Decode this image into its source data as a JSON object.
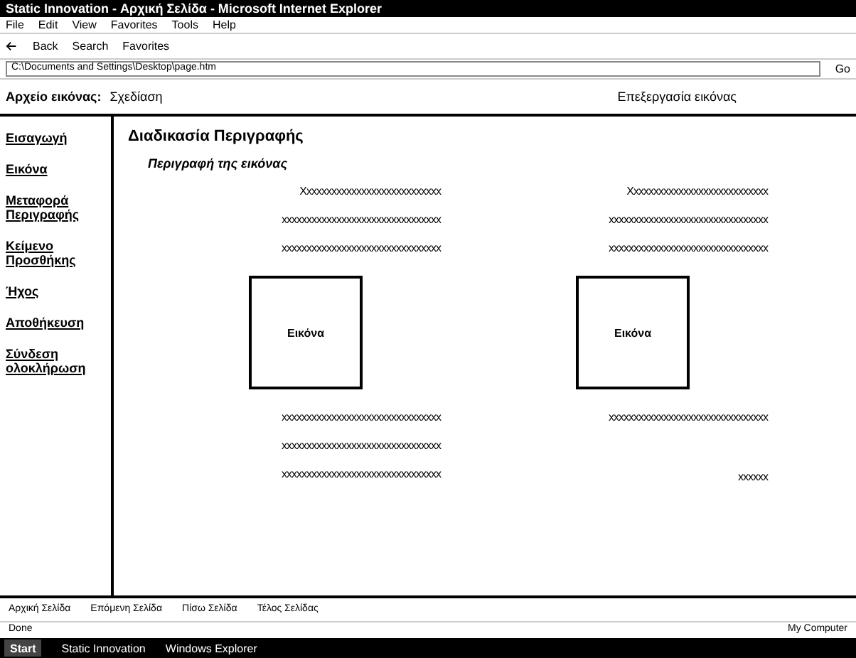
{
  "window": {
    "title": "Static Innovation - Αρχική Σελίδα - Microsoft Internet Explorer"
  },
  "menu": [
    "File",
    "Edit",
    "View",
    "Favorites",
    "Tools",
    "Help"
  ],
  "toolbar": [
    "Back",
    "Search",
    "Favorites"
  ],
  "address": {
    "value": "C:\\Documents and Settings\\Desktop\\page.htm",
    "go": "Go"
  },
  "header": {
    "label": "Αρχείο εικόνας:",
    "value": "Σχεδίαση",
    "right": "Επεξεργασία εικόνας"
  },
  "sidebar": [
    {
      "label": "Εισαγωγή"
    },
    {
      "label": "Εικόνα"
    },
    {
      "label": "Μεταφορά Περιγραφής"
    },
    {
      "label": "Κείμενο Προσθήκης"
    },
    {
      "label": "Ήχος"
    },
    {
      "label": "Αποθήκευση"
    },
    {
      "label": "Σύνδεση ολοκλήρωση"
    }
  ],
  "content": {
    "title": "Διαδικασία Περιγραφής",
    "subtitle": "Περιγραφή της εικόνας",
    "columns": [
      {
        "lines": [
          "Χxxxxxxxxxxxxxxxxxxxxxxxxxxx",
          "xxxxxxxxxxxxxxxxxxxxxxxxxxxxxxxx",
          "xxxxxxxxxxxxxxxxxxxxxxxxxxxxxxxx"
        ],
        "box": "Εικόνα",
        "after": [
          "xxxxxxxxxxxxxxxxxxxxxxxxxxxxxxxx",
          "xxxxxxxxxxxxxxxxxxxxxxxxxxxxxxxx",
          "xxxxxxxxxxxxxxxxxxxxxxxxxxxxxxxx"
        ]
      },
      {
        "lines": [
          "Χxxxxxxxxxxxxxxxxxxxxxxxxxxx",
          "xxxxxxxxxxxxxxxxxxxxxxxxxxxxxxxx",
          "xxxxxxxxxxxxxxxxxxxxxxxxxxxxxxxx"
        ],
        "box": "Εικόνα",
        "after": [
          "xxxxxxxxxxxxxxxxxxxxxxxxxxxxxxxx",
          "xxxxxx"
        ]
      }
    ]
  },
  "footer_links": [
    "Αρχική Σελίδα",
    "Επόμενη Σελίδα",
    "Πίσω Σελίδα",
    "Τέλος Σελίδας"
  ],
  "status": {
    "left": "Done",
    "right": "My Computer"
  },
  "taskbar": {
    "start": "Start",
    "tasks": [
      "Static Innovation",
      "Windows Explorer"
    ]
  }
}
